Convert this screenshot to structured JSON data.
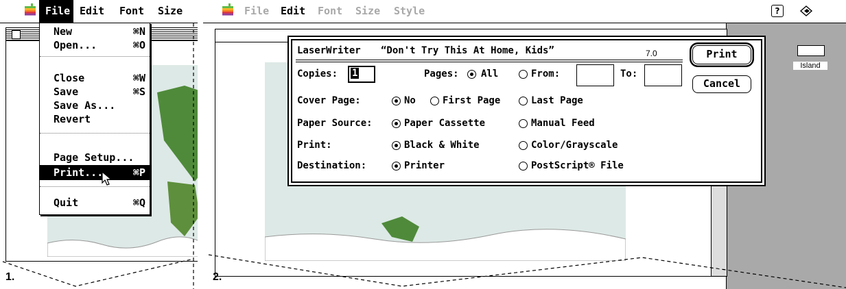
{
  "panel1": {
    "step_label": "1.",
    "menubar": {
      "items": [
        "File",
        "Edit",
        "Font",
        "Size"
      ]
    },
    "file_menu": {
      "items": [
        {
          "label": "New",
          "shortcut": "⌘N"
        },
        {
          "label": "Open...",
          "shortcut": "⌘O"
        },
        {
          "label": "Close",
          "shortcut": "⌘W"
        },
        {
          "label": "Save",
          "shortcut": "⌘S"
        },
        {
          "label": "Save As...",
          "shortcut": ""
        },
        {
          "label": "Revert",
          "shortcut": ""
        },
        {
          "label": "Page Setup...",
          "shortcut": ""
        },
        {
          "label": "Print...",
          "shortcut": "⌘P"
        },
        {
          "label": "Quit",
          "shortcut": "⌘Q"
        }
      ],
      "highlighted": "Print..."
    }
  },
  "panel2": {
    "step_label": "2.",
    "menubar": {
      "items": [
        "File",
        "Edit",
        "Font",
        "Size",
        "Style"
      ],
      "active": "Edit"
    },
    "desktop_icon_label": "Island",
    "print_dialog": {
      "printer": "LaserWriter",
      "title": "“Don't Try This At Home, Kids”",
      "version": "7.0",
      "copies_label": "Copies:",
      "copies_value": "1",
      "pages_label": "Pages:",
      "pages_all": "All",
      "from_label": "From:",
      "to_label": "To:",
      "from_value": "",
      "to_value": "",
      "cover_label": "Cover Page:",
      "cover_options": [
        "No",
        "First Page",
        "Last Page"
      ],
      "cover_selected": "No",
      "source_label": "Paper Source:",
      "source_options": [
        "Paper Cassette",
        "Manual Feed"
      ],
      "source_selected": "Paper Cassette",
      "print_label": "Print:",
      "print_options": [
        "Black & White",
        "Color/Grayscale"
      ],
      "print_selected": "Black & White",
      "dest_label": "Destination:",
      "dest_options": [
        "Printer",
        "PostScript® File"
      ],
      "dest_selected": "Printer",
      "print_button": "Print",
      "cancel_button": "Cancel"
    }
  },
  "colors": {
    "gray_area": "#a9a9a9",
    "map_bg": "#dde9e6",
    "land": "#4f8a3a",
    "highlight": "#000000"
  }
}
